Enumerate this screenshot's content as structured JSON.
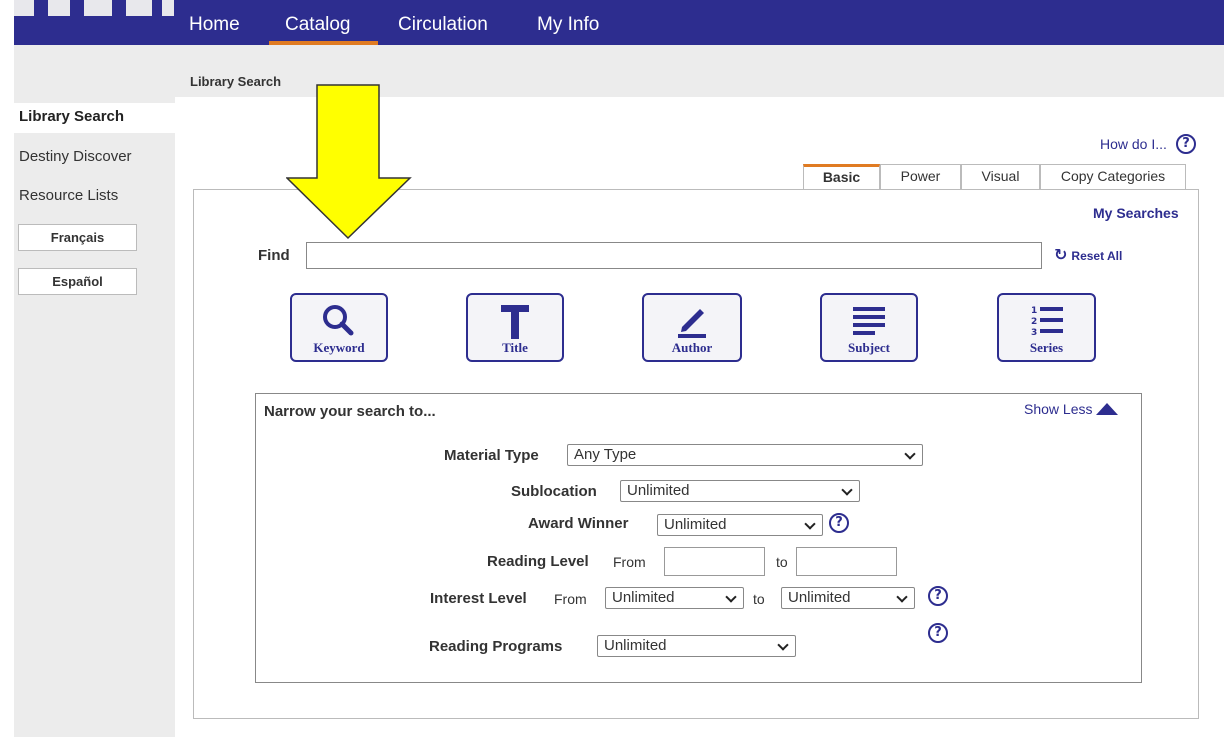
{
  "nav": {
    "tabs": [
      "Home",
      "Catalog",
      "Circulation",
      "My Info"
    ],
    "active": "Catalog"
  },
  "breadcrumb": "Library Search",
  "sidebar": {
    "items": [
      "Library Search",
      "Destiny Discover",
      "Resource Lists"
    ],
    "active": "Library Search",
    "languages": [
      "Français",
      "Español"
    ]
  },
  "help": {
    "label": "How do I...",
    "icon": "?"
  },
  "tabs": {
    "items": [
      "Basic",
      "Power",
      "Visual",
      "Copy Categories"
    ],
    "active": "Basic"
  },
  "search": {
    "my_searches": "My Searches",
    "find_label": "Find",
    "find_value": "",
    "reset_all": "Reset All",
    "types": [
      "Keyword",
      "Title",
      "Author",
      "Subject",
      "Series"
    ]
  },
  "narrow": {
    "title": "Narrow your search to...",
    "show_less": "Show Less",
    "material_type": {
      "label": "Material Type",
      "value": "Any Type"
    },
    "sublocation": {
      "label": "Sublocation",
      "value": "Unlimited"
    },
    "award_winner": {
      "label": "Award Winner",
      "value": "Unlimited"
    },
    "reading_level": {
      "label": "Reading Level",
      "from": "From",
      "to": "to"
    },
    "interest_level": {
      "label": "Interest Level",
      "from": "From",
      "from_value": "Unlimited",
      "to": "to",
      "to_value": "Unlimited"
    },
    "reading_programs": {
      "label": "Reading Programs",
      "value": "Unlimited"
    }
  },
  "colors": {
    "nav_bg": "#2d2d8f",
    "accent": "#e07b22",
    "annotation_arrow": "#ffff00"
  }
}
